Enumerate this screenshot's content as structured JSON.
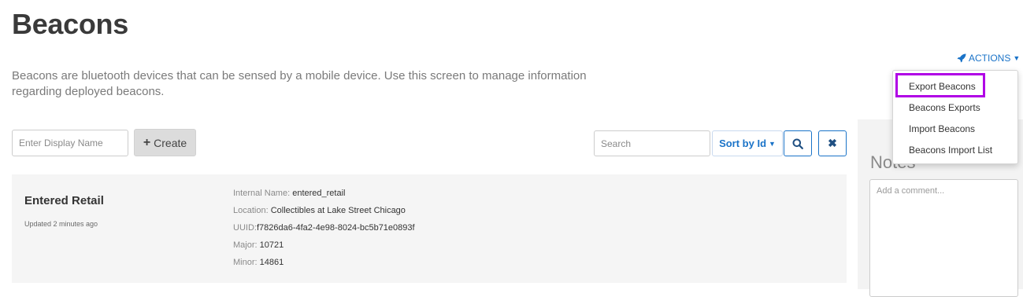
{
  "page": {
    "title": "Beacons",
    "description": "Beacons are bluetooth devices that can be sensed by a mobile device. Use this screen to manage information regarding deployed beacons."
  },
  "actions": {
    "label": "ACTIONS",
    "icon": "rocket-icon",
    "menu": [
      {
        "label": "Export Beacons",
        "highlighted": true
      },
      {
        "label": "Beacons Exports"
      },
      {
        "label": "Import Beacons"
      },
      {
        "label": "Beacons Import List"
      }
    ]
  },
  "toolbar": {
    "display_name_placeholder": "Enter Display Name",
    "create_label": "Create",
    "search_placeholder": "Search",
    "sort_label": "Sort by Id"
  },
  "beacon": {
    "name": "Entered Retail",
    "updated": "Updated 2 minutes ago",
    "fields": [
      {
        "label": "Internal Name:",
        "value": "entered_retail"
      },
      {
        "label": "Location:",
        "value": "Collectibles at Lake Street Chicago"
      },
      {
        "label": "UUID:",
        "value": "f7826da6-4fa2-4e98-8024-bc5b71e0893f"
      },
      {
        "label": "Major:",
        "value": "10721"
      },
      {
        "label": "Minor:",
        "value": "14861"
      }
    ]
  },
  "notes": {
    "title": "Notes",
    "placeholder": "Add a comment..."
  },
  "colors": {
    "accent": "#1a73c8",
    "highlight": "#b000e6"
  }
}
